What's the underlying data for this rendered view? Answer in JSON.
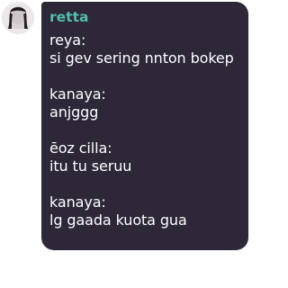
{
  "chat": {
    "sender_name": "retta",
    "sender_color": "#53bdb0",
    "bubble_color": "#2d2738",
    "avatar_icon": "profile-photo-icon",
    "messages": [
      {
        "author": "reya:",
        "text": "si gev sering nnton bokep"
      },
      {
        "author": "kanaya:",
        "text": "anjggg"
      },
      {
        "author": "ēoz cilla:",
        "text": "itu tu seruu"
      },
      {
        "author": "kanaya:",
        "text": "lg gaada kuota gua"
      }
    ]
  }
}
